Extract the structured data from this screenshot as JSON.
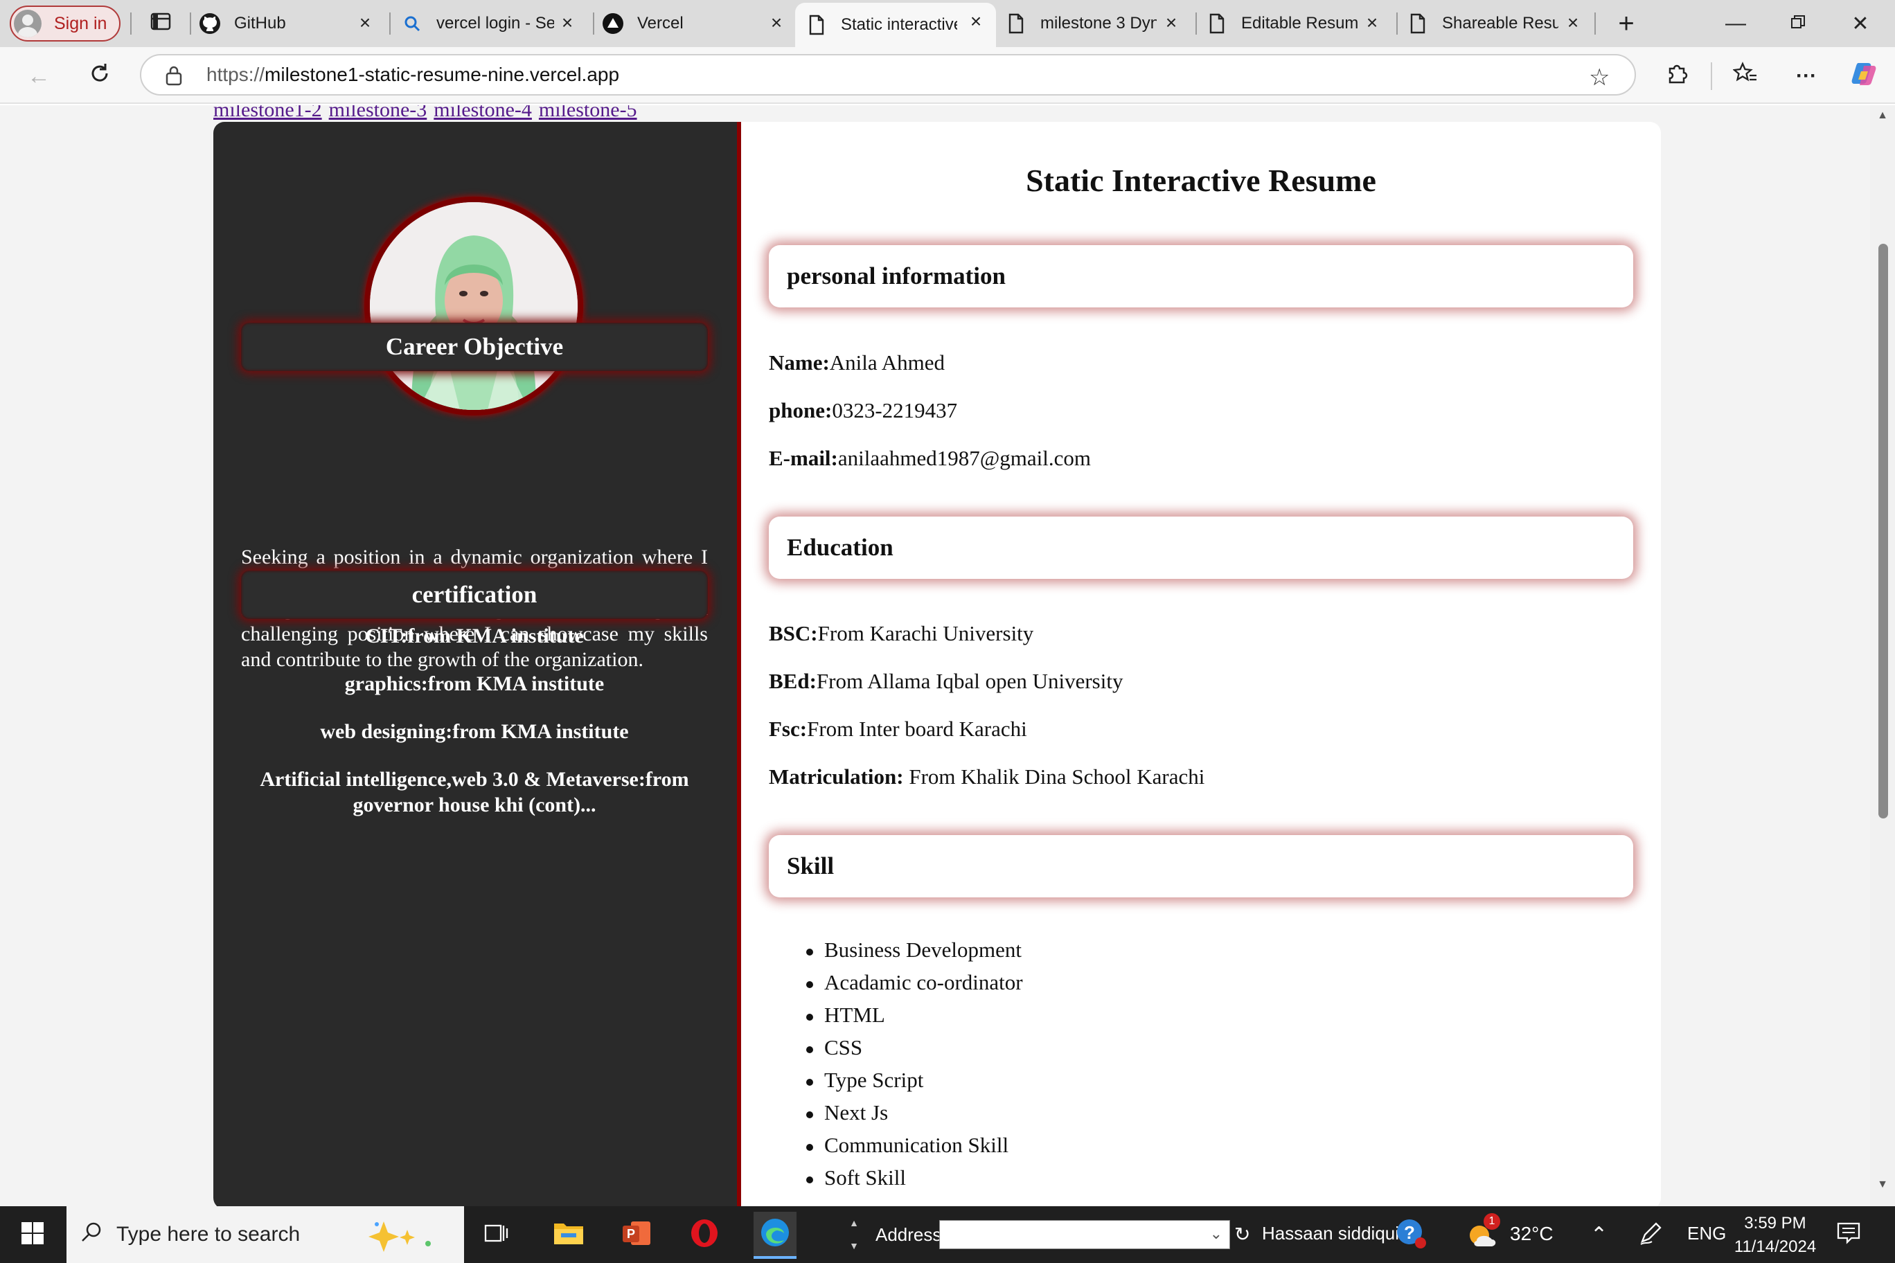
{
  "browser": {
    "signin_label": "Sign in",
    "tabs": [
      {
        "label": "GitHub",
        "icon": "github-icon"
      },
      {
        "label": "vercel login - Se",
        "icon": "search-icon"
      },
      {
        "label": "Vercel",
        "icon": "vercel-icon"
      },
      {
        "label": "Static interactive",
        "icon": "document-icon"
      },
      {
        "label": "milestone 3 Dyn",
        "icon": "document-icon"
      },
      {
        "label": "Editable Resum",
        "icon": "document-icon"
      },
      {
        "label": "Shareable Resu",
        "icon": "document-icon"
      }
    ],
    "url_protocol": "https://",
    "url_host": "milestone1-static-resume-nine.vercel.app"
  },
  "page": {
    "milestone_links": [
      "milestone1-2",
      "milestone-3",
      "milestone-4",
      "milestone-5"
    ],
    "resume_title": "Static Interactive Resume",
    "career": {
      "heading": "Career Objective",
      "text": "Seeking a position in a dynamic organization where I can launch my career and work towards building a strong skill set. A hard working individual looking for a challenging position where I can showcase my skills and contribute to the growth of the organization."
    },
    "certification": {
      "heading": "certification",
      "items": [
        "CIT:from KMA institute",
        "graphics:from KMA institute",
        "web designing:from KMA institute",
        "Artificial intelligence,web 3.0 & Metaverse:from governor house khi (cont)..."
      ]
    },
    "personal": {
      "heading": "personal information",
      "rows": [
        {
          "label": "Name:",
          "value": "Anila Ahmed"
        },
        {
          "label": "phone:",
          "value": "0323-2219437"
        },
        {
          "label": "E-mail:",
          "value": "anilaahmed1987@gmail.com"
        }
      ]
    },
    "education": {
      "heading": "Education",
      "rows": [
        {
          "label": "BSC:",
          "value": "From Karachi University"
        },
        {
          "label": "BEd:",
          "value": "From Allama Iqbal open University"
        },
        {
          "label": "Fsc:",
          "value": "From Inter board Karachi"
        },
        {
          "label": "Matriculation:",
          "value": " From Khalik Dina School Karachi"
        }
      ]
    },
    "skill": {
      "heading": "Skill",
      "items": [
        "Business Development",
        "Acadamic co-ordinator",
        "HTML",
        "CSS",
        "Type Script",
        "Next Js",
        "Communication Skill",
        "Soft Skill"
      ]
    }
  },
  "taskbar": {
    "search_placeholder": "Type here to search",
    "address_label": "Address",
    "user_name": "Hassaan siddiqui",
    "weather_temp": "32°C",
    "weather_badge": "1",
    "language": "ENG",
    "time": "3:59 PM",
    "date": "11/14/2024"
  },
  "colors": {
    "accent_dark_red": "#8b0000",
    "sidebar_bg": "#2a2a2a",
    "link_purple": "#551a8b",
    "signin_red": "#b02020"
  }
}
